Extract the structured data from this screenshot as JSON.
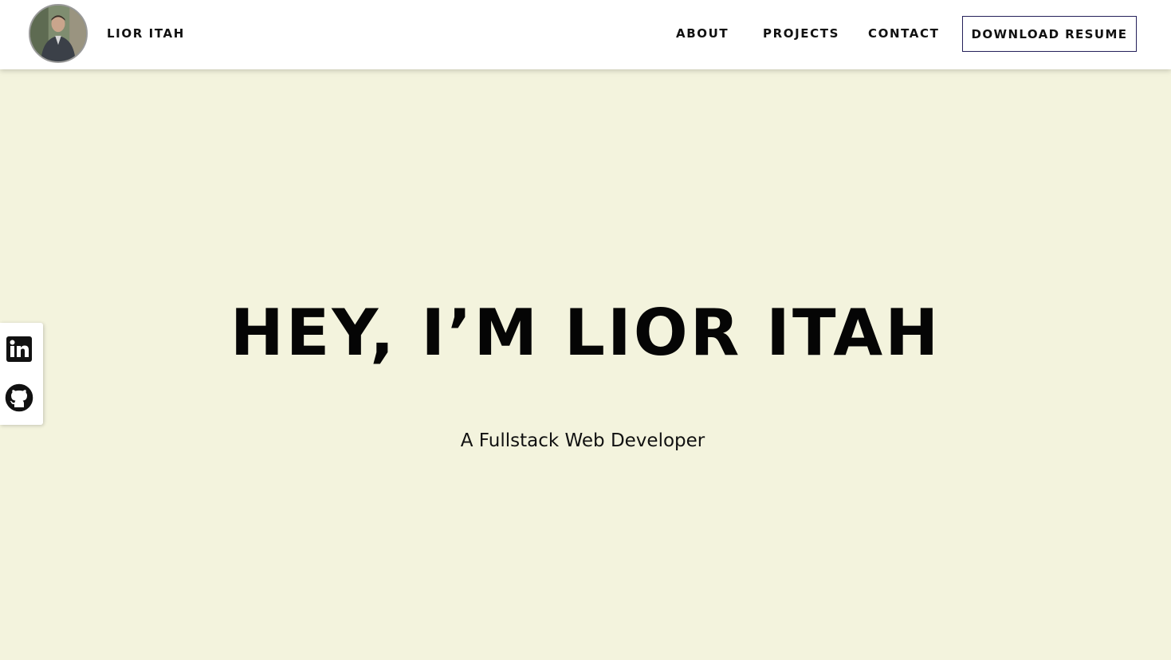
{
  "header": {
    "brand_name": "LIOR ITAH",
    "avatar_alt": "avatar",
    "nav": {
      "about": "ABOUT",
      "projects": "PROJECTS",
      "contact": "CONTACT"
    },
    "resume_button": "DOWNLOAD RESUME"
  },
  "social": {
    "linkedin_icon": "linkedin-icon",
    "github_icon": "github-icon"
  },
  "hero": {
    "title": "HEY, I’M LIOR ITAH",
    "subtitle": "A Fullstack Web Developer"
  },
  "colors": {
    "hero_background": "#f3f3dd",
    "header_background": "#ffffff",
    "button_border": "#24205a",
    "text": "#050505"
  }
}
